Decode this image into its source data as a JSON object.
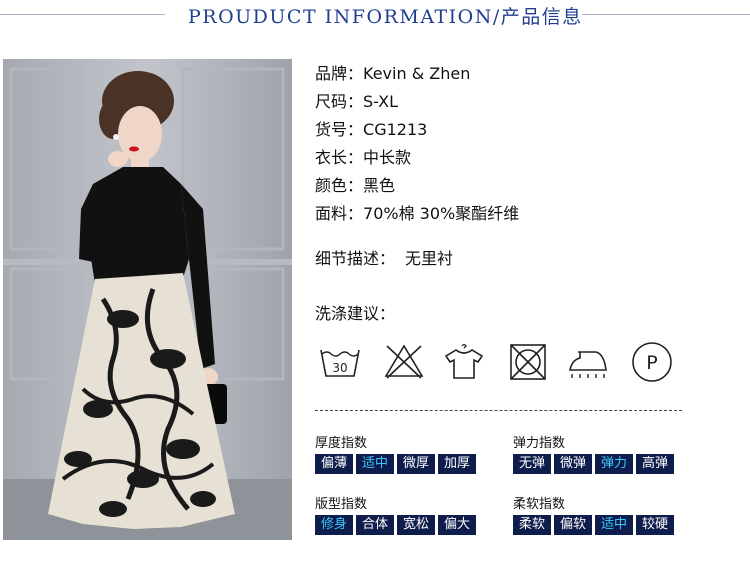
{
  "header": {
    "title": "PROUDUCT INFORMATION/产品信息"
  },
  "product": {
    "brand_label": "品牌：",
    "brand": "Kevin & Zhen",
    "size_label": "尺码：",
    "size": "S-XL",
    "sku_label": "货号：",
    "sku": "CG1213",
    "length_label": "衣长：",
    "length": "中长款",
    "color_label": "颜色：",
    "color": "黑色",
    "fabric_label": "面料：",
    "fabric": "70%棉 30%聚酯纤维"
  },
  "detail": {
    "label": "细节描述：",
    "value": "无里衬"
  },
  "wash": {
    "label": "洗涤建议："
  },
  "care_icons": [
    {
      "name": "wash-30-icon",
      "text": "30"
    },
    {
      "name": "no-bleach-icon"
    },
    {
      "name": "hang-dry-icon"
    },
    {
      "name": "no-tumble-dry-icon"
    },
    {
      "name": "iron-icon"
    },
    {
      "name": "dry-clean-p-icon",
      "text": "P"
    }
  ],
  "indices": {
    "thickness": {
      "title": "厚度指数",
      "options": [
        "偏薄",
        "适中",
        "微厚",
        "加厚"
      ],
      "selected": 1
    },
    "elasticity": {
      "title": "弹力指数",
      "options": [
        "无弹",
        "微弹",
        "弹力",
        "高弹"
      ],
      "selected": 2
    },
    "fit": {
      "title": "版型指数",
      "options": [
        "修身",
        "合体",
        "宽松",
        "偏大"
      ],
      "selected": 0
    },
    "softness": {
      "title": "柔软指数",
      "options": [
        "柔软",
        "偏软",
        "适中",
        "较硬"
      ],
      "selected": 2
    }
  },
  "colors": {
    "accent": "#1f3f8f",
    "box_bg": "#0f1d4c",
    "selected_text": "#3ec6ff"
  }
}
